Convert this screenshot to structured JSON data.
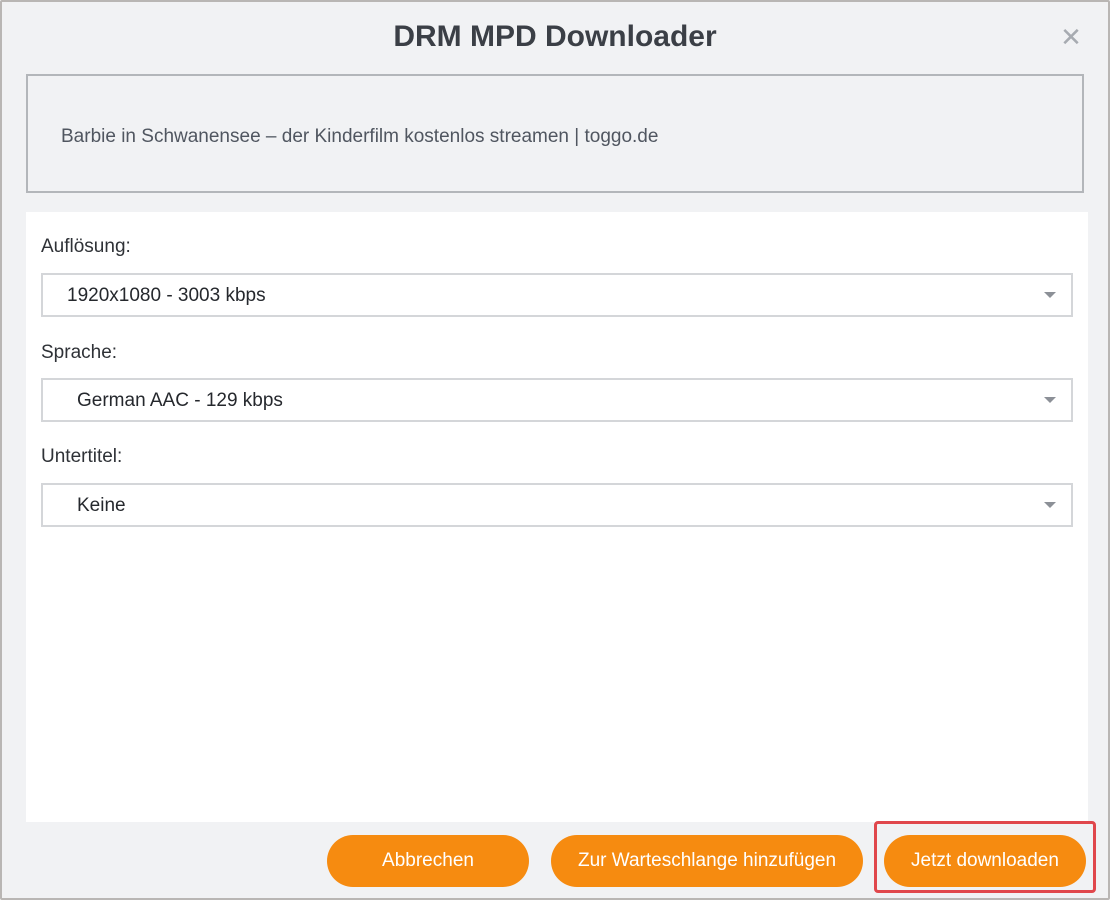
{
  "dialog": {
    "title": "DRM MPD Downloader",
    "close_icon": "close-icon"
  },
  "info": {
    "text": "Barbie in Schwanensee – der Kinderfilm kostenlos streamen | toggo.de"
  },
  "fields": {
    "resolution": {
      "label": "Auflösung:",
      "value": "1920x1080 - 3003 kbps"
    },
    "language": {
      "label": "Sprache:",
      "value": "German AAC - 129 kbps"
    },
    "subtitles": {
      "label": "Untertitel:",
      "value": "Keine"
    }
  },
  "buttons": {
    "cancel": "Abbrechen",
    "queue": "Zur Warteschlange hinzufügen",
    "download": "Jetzt downloaden"
  },
  "colors": {
    "accent": "#f68b10",
    "highlight": "#e0474c",
    "background": "#f1f2f4"
  }
}
